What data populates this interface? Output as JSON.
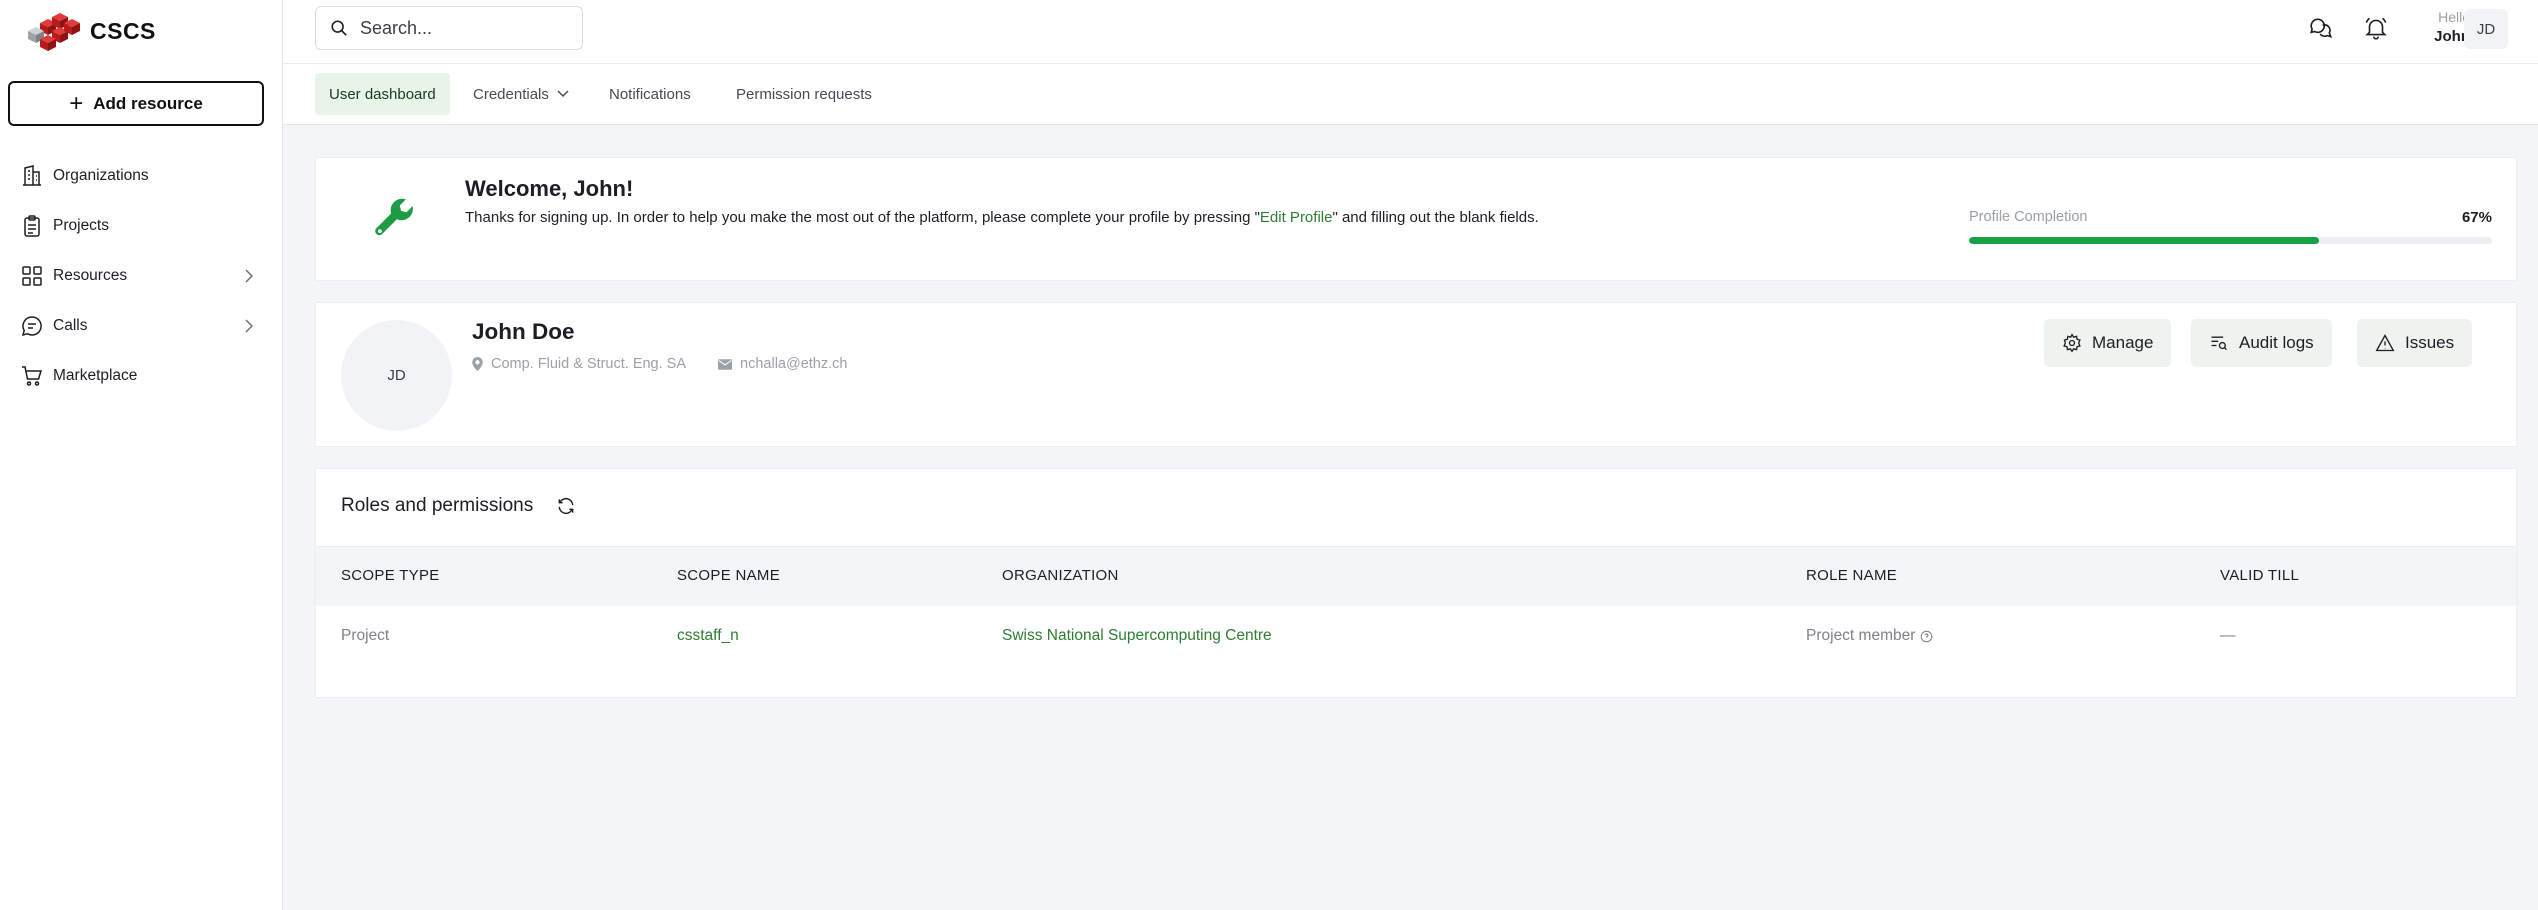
{
  "brand": {
    "name": "CSCS"
  },
  "sidebar": {
    "add_label": "Add resource",
    "items": [
      {
        "label": "Organizations",
        "icon": "building-icon",
        "has_children": false
      },
      {
        "label": "Projects",
        "icon": "clipboard-icon",
        "has_children": false
      },
      {
        "label": "Resources",
        "icon": "grid-icon",
        "has_children": true
      },
      {
        "label": "Calls",
        "icon": "chat-icon",
        "has_children": true
      },
      {
        "label": "Marketplace",
        "icon": "cart-icon",
        "has_children": false
      }
    ]
  },
  "topbar": {
    "search_placeholder": "Search...",
    "greeting": "Hello",
    "user_first": "John",
    "user_initials": "JD"
  },
  "tabs": [
    {
      "label": "User dashboard",
      "active": true
    },
    {
      "label": "Credentials",
      "active": false,
      "dropdown": true
    },
    {
      "label": "Notifications",
      "active": false
    },
    {
      "label": "Permission requests",
      "active": false
    }
  ],
  "welcome": {
    "title": "Welcome, John!",
    "text_before": "Thanks for signing up. In order to help you make the most out of the platform, please complete your profile by pressing \"",
    "link": "Edit Profile",
    "text_after": "\" and filling out the blank fields.",
    "progress_label": "Profile Completion",
    "progress_value": "67%",
    "progress_fraction": 0.67
  },
  "profile": {
    "initials": "JD",
    "name": "John Doe",
    "organization": "Comp. Fluid & Struct. Eng. SA",
    "email": "nchalla@ethz.ch",
    "actions": {
      "manage": "Manage",
      "audit": "Audit logs",
      "issues": "Issues"
    }
  },
  "roles": {
    "title": "Roles and permissions",
    "columns": [
      "SCOPE TYPE",
      "SCOPE NAME",
      "ORGANIZATION",
      "ROLE NAME",
      "VALID TILL"
    ],
    "rows": [
      {
        "scope_type": "Project",
        "scope_name": "csstaff_n",
        "organization": "Swiss National Supercomputing Centre",
        "role_name": "Project member",
        "valid_till": "—"
      }
    ]
  },
  "colors": {
    "accent": "#19a244",
    "link": "#2e7d32",
    "active_tab_bg": "#e8f3e9"
  }
}
